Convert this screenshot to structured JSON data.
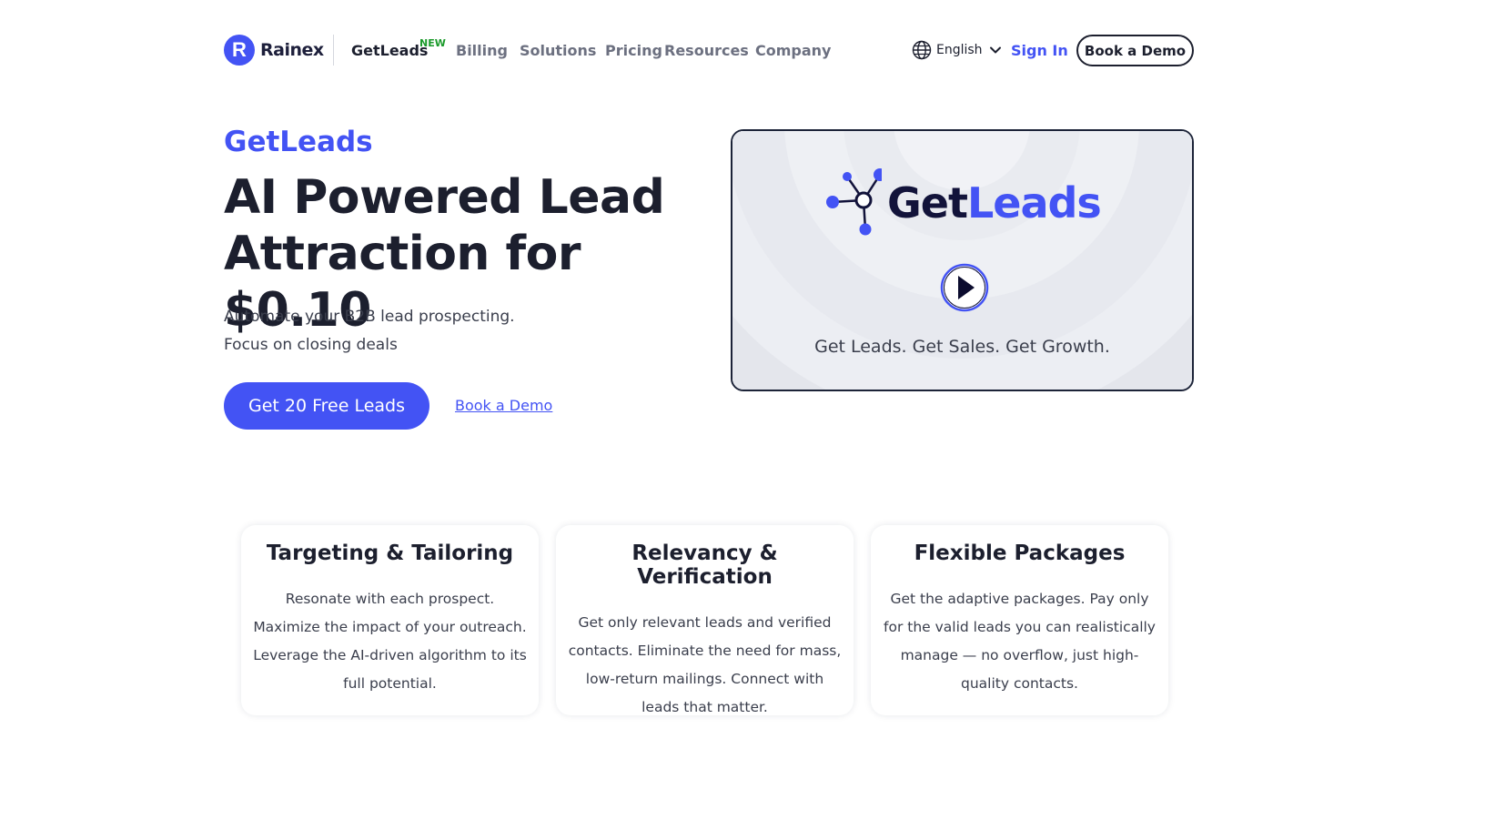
{
  "brand": {
    "logo_letter": "R",
    "logo_text": "Rainex"
  },
  "nav": {
    "items": [
      {
        "label": "GetLeads",
        "badge": "NEW"
      },
      {
        "label": "Billing"
      },
      {
        "label": "Solutions"
      },
      {
        "label": "Pricing"
      },
      {
        "label": "Resources"
      },
      {
        "label": "Company"
      }
    ],
    "language": "English",
    "sign_in": "Sign In",
    "book_demo": "Book a Demo"
  },
  "hero": {
    "eyebrow": "GetLeads",
    "title_line1": "AI Powered Lead",
    "title_line2": "Attraction for $0.10",
    "sub_line1": "Automate your B2B lead prospecting.",
    "sub_line2": "Focus on closing deals",
    "cta": "Get 20 Free Leads",
    "demo_link": "Book a Demo"
  },
  "video": {
    "logo_dark": "Get",
    "logo_blue": "Leads",
    "tagline": "Get Leads. Get Sales. Get Growth.",
    "play_icon": "play-icon"
  },
  "features": [
    {
      "title": "Targeting & Tailoring",
      "text": "Resonate with each prospect. Maximize the impact of your outreach. Leverage the AI-driven algorithm to its full potential."
    },
    {
      "title": "Relevancy & Verification",
      "text": "Get only relevant leads and verified contacts. Eliminate the need for mass, low-return mailings. Connect with leads that matter."
    },
    {
      "title": "Flexible Packages",
      "text": "Get the adaptive packages. Pay only for the valid leads you can realistically manage — no overflow, just high-quality contacts."
    }
  ],
  "colors": {
    "accent": "#4353f4",
    "dark": "#1c1f2e",
    "badge_green": "#1a9a2a"
  }
}
